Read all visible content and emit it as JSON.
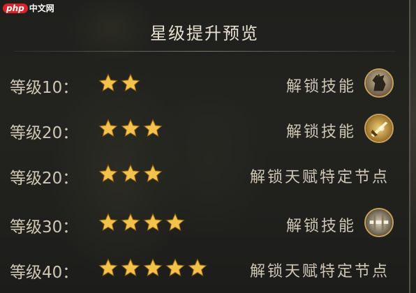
{
  "watermark": {
    "logo": "php",
    "text": "中文网"
  },
  "title": "星级提升预览",
  "rows": [
    {
      "level": "等级10：",
      "stars": 2,
      "unlock": "解锁技能",
      "icon": "horse-icon"
    },
    {
      "level": "等级20：",
      "stars": 3,
      "unlock": "解锁技能",
      "icon": "golden-sword-icon"
    },
    {
      "level": "等级20：",
      "stars": 3,
      "unlock": "解锁天赋特定节点"
    },
    {
      "level": "等级30：",
      "stars": 4,
      "unlock": "解锁技能",
      "icon": "silver-weapon-icon"
    },
    {
      "level": "等级40：",
      "stars": 5,
      "unlock": "解锁天赋特定节点"
    }
  ],
  "colors": {
    "star": "#f2c24a",
    "text": "#cfc7b3",
    "title": "#e8e1cf",
    "icon_border": "#c8a25a"
  }
}
